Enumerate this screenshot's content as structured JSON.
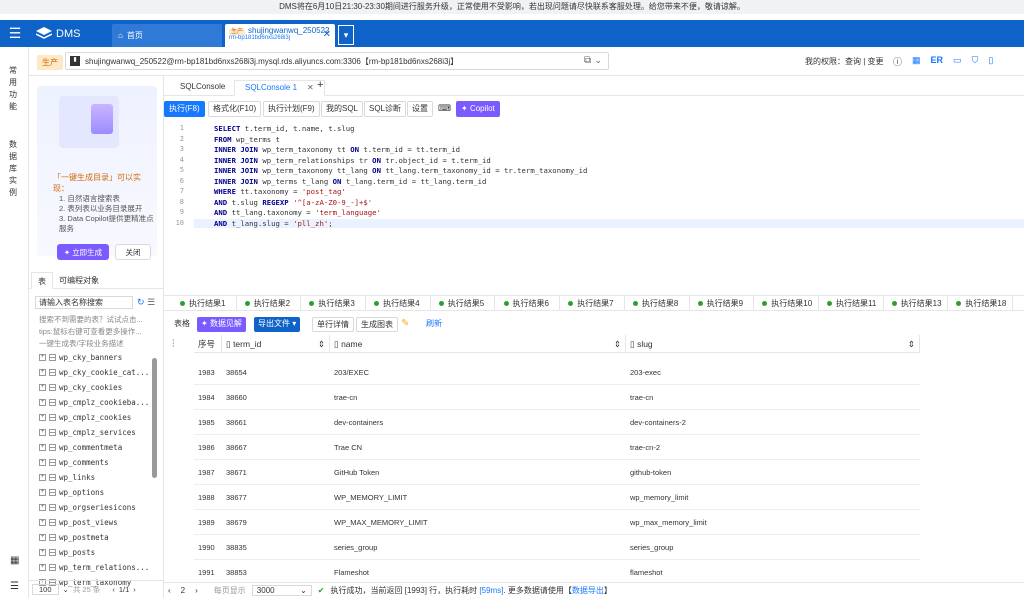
{
  "notice": "DMS将在6月10日21:30-23:30期间进行服务升级，正常使用不受影响，若出现问题请尽快联系客服处理。给您带来不便，敬请谅解。",
  "app": {
    "name": "DMS"
  },
  "tabs": [
    {
      "label": "首页"
    },
    {
      "env": "生产",
      "label": "shujingwanwq_250522",
      "sub": "rm-bp181bd6nxs268i3j"
    }
  ],
  "rail": [
    "常用功能",
    "数据库实例"
  ],
  "conn": {
    "env": "生产",
    "value": "shujingwanwq_250522@rm-bp181bd6nxs268i3j.mysql.rds.aliyuncs.com:3306【rm-bp181bd6nxs268i3j】"
  },
  "perm": "我的权限：查询 | 变更",
  "promo": {
    "title": "「一键生成目录」可以实现：",
    "items": [
      "1. 自然语言搜索表",
      "2. 表列表以业务目录展开",
      "3. Data Copilot提供更精准点服务"
    ],
    "gen": "立即生成",
    "close": "关闭"
  },
  "left_tabs": [
    "表",
    "可编程对象"
  ],
  "table_search_placeholder": "请输入表名称搜索",
  "hints": [
    "搜索不到需要的表？试试点击...",
    "tips:鼠标右键可查看更多操作...",
    "一键生成表/字段业务描述"
  ],
  "tables": [
    "wp_cky_banners",
    "wp_cky_cookie_cat...",
    "wp_cky_cookies",
    "wp_cmplz_cookieba...",
    "wp_cmplz_cookies",
    "wp_cmplz_services",
    "wp_commentmeta",
    "wp_comments",
    "wp_links",
    "wp_options",
    "wp_orgseriesicons",
    "wp_post_views",
    "wp_postmeta",
    "wp_posts",
    "wp_term_relations...",
    "wp_term_taxonomy"
  ],
  "left_pager": {
    "size": "100",
    "total": "共 25 条",
    "page": "1/1"
  },
  "sql_tabs": [
    "SQLConsole",
    "SQLConsole 1"
  ],
  "toolbar": [
    "执行(F8)",
    "格式化(F10)",
    "执行计划(F9)",
    "我的SQL",
    "SQL诊断",
    "设置",
    "Copilot"
  ],
  "sql_lines": [
    [
      "SELECT",
      " t.term_id, t.name, t.slug"
    ],
    [
      "FROM",
      " wp_terms t"
    ],
    [
      "INNER JOIN",
      " wp_term_taxonomy tt ",
      "ON",
      " t.term_id = tt.term_id"
    ],
    [
      "INNER JOIN",
      " wp_term_relationships tr ",
      "ON",
      " tr.object_id = t.term_id"
    ],
    [
      "INNER JOIN",
      " wp_term_taxonomy tt_lang ",
      "ON",
      " tt_lang.term_taxonomy_id = tr.term_taxonomy_id"
    ],
    [
      "INNER JOIN",
      " wp_terms t_lang ",
      "ON",
      " t_lang.term_id = tt_lang.term_id"
    ],
    [
      "WHERE",
      " tt.taxonomy = ",
      "'post_tag'"
    ],
    [
      "AND",
      " t.slug ",
      "REGEXP",
      " '^[a-zA-Z0-9_-]+$'"
    ],
    [
      "AND",
      " tt_lang.taxonomy = ",
      "'term_language'"
    ],
    [
      "AND",
      " t_lang.slug = ",
      "'pll_zh'",
      ";"
    ]
  ],
  "result_tabs": [
    "执行结果1",
    "执行结果2",
    "执行结果3",
    "执行结果4",
    "执行结果5",
    "执行结果6",
    "执行结果7",
    "执行结果8",
    "执行结果9",
    "执行结果10",
    "执行结果11",
    "执行结果13",
    "执行结果18"
  ],
  "result_toolbar": [
    "表格",
    "数据见解",
    "导出文件",
    "单行详情",
    "生成图表",
    "刷新"
  ],
  "columns": [
    "序号",
    "term_id",
    "name",
    "slug"
  ],
  "rows": [
    [
      "1983",
      "38654",
      "203/EXEC",
      "203-exec"
    ],
    [
      "1984",
      "38660",
      "trae-cn",
      "trae-cn"
    ],
    [
      "1985",
      "38661",
      "dev-containers",
      "dev-containers-2"
    ],
    [
      "1986",
      "38667",
      "Trae CN",
      "trae-cn-2"
    ],
    [
      "1987",
      "38671",
      "GitHub Token",
      "github-token"
    ],
    [
      "1988",
      "38677",
      "WP_MEMORY_LIMIT",
      "wp_memory_limit"
    ],
    [
      "1989",
      "38679",
      "WP_MAX_MEMORY_LIMIT",
      "wp_max_memory_limit"
    ],
    [
      "1990",
      "38835",
      "series_group",
      "series_group"
    ],
    [
      "1991",
      "38853",
      "Flameshot",
      "flameshot"
    ]
  ],
  "status": {
    "page": "2",
    "page_label": "每页显示",
    "page_size": "3000",
    "msg": "执行成功，当前返回 [1993] 行，执行耗时",
    "time": "[59ms]",
    "more": "更多数据请使用【",
    "link": "数据导出",
    "end": "】"
  }
}
